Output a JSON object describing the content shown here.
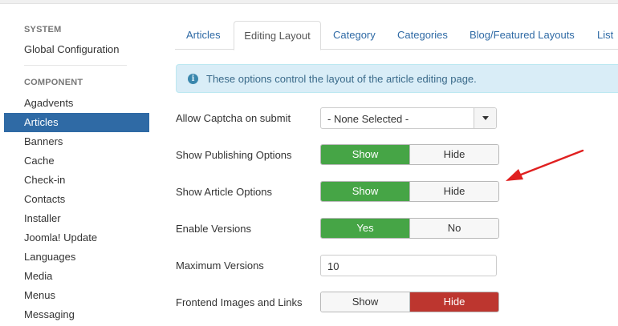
{
  "sidebar": {
    "system_heading": "SYSTEM",
    "global_configuration": "Global Configuration",
    "component_heading": "COMPONENT",
    "items": [
      {
        "label": "Agadvents",
        "active": false
      },
      {
        "label": "Articles",
        "active": true
      },
      {
        "label": "Banners",
        "active": false
      },
      {
        "label": "Cache",
        "active": false
      },
      {
        "label": "Check-in",
        "active": false
      },
      {
        "label": "Contacts",
        "active": false
      },
      {
        "label": "Installer",
        "active": false
      },
      {
        "label": "Joomla! Update",
        "active": false
      },
      {
        "label": "Languages",
        "active": false
      },
      {
        "label": "Media",
        "active": false
      },
      {
        "label": "Menus",
        "active": false
      },
      {
        "label": "Messaging",
        "active": false
      }
    ]
  },
  "tabs": [
    {
      "label": "Articles",
      "active": false
    },
    {
      "label": "Editing Layout",
      "active": true
    },
    {
      "label": "Category",
      "active": false
    },
    {
      "label": "Categories",
      "active": false
    },
    {
      "label": "Blog/Featured Layouts",
      "active": false
    },
    {
      "label": "List",
      "active": false
    }
  ],
  "info": {
    "icon": "info-icon",
    "text": "These options control the layout of the article editing page."
  },
  "form": {
    "captcha": {
      "label": "Allow Captcha on submit",
      "value": "- None Selected -"
    },
    "publishing_options": {
      "label": "Show Publishing Options",
      "left": "Show",
      "right": "Hide",
      "selected": "Show"
    },
    "article_options": {
      "label": "Show Article Options",
      "left": "Show",
      "right": "Hide",
      "selected": "Show"
    },
    "enable_versions": {
      "label": "Enable Versions",
      "left": "Yes",
      "right": "No",
      "selected": "Yes"
    },
    "maximum_versions": {
      "label": "Maximum Versions",
      "value": "10"
    },
    "frontend_images": {
      "label": "Frontend Images and Links",
      "left": "Show",
      "right": "Hide",
      "selected": "Hide"
    }
  },
  "colors": {
    "active_sidebar": "#2f6aa5",
    "toggle_green": "#46a546",
    "toggle_red": "#bd362f",
    "annotation_arrow": "#e02020"
  }
}
